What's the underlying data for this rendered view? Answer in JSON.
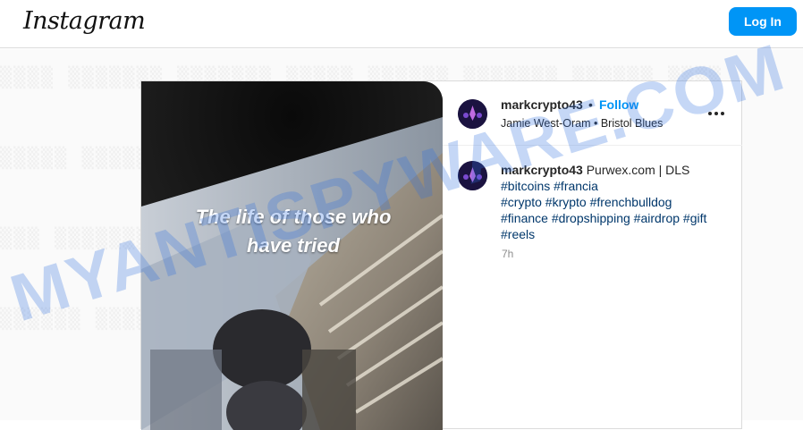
{
  "topbar": {
    "logo": "Instagram",
    "login_label": "Log In"
  },
  "colors": {
    "accent": "#0095f6",
    "hashtag": "#00376b",
    "muted": "#8e8e8e",
    "watermark": "#2f6fe0"
  },
  "post": {
    "overlay_line1": "The life of those who",
    "overlay_line2": "have tried",
    "author": "markcrypto43",
    "separator": "•",
    "follow_label": "Follow",
    "audio_artist": "Jamie West-Oram",
    "audio_sep": "•",
    "audio_track": "Bristol Blues",
    "more_icon": "more-horizontal-icon",
    "caption_user": "markcrypto43",
    "caption_text": "Purwex.com | DLS",
    "hashtags_line1": "#bitcoins #francia",
    "hashtags_line2": "#crypto #krypto #frenchbulldog",
    "hashtags_line3": "#finance #dropshipping #airdrop #gift",
    "hashtags_line4": "#reels",
    "time": "7h"
  },
  "watermark_text": "MYANTISPYWARE.COM"
}
